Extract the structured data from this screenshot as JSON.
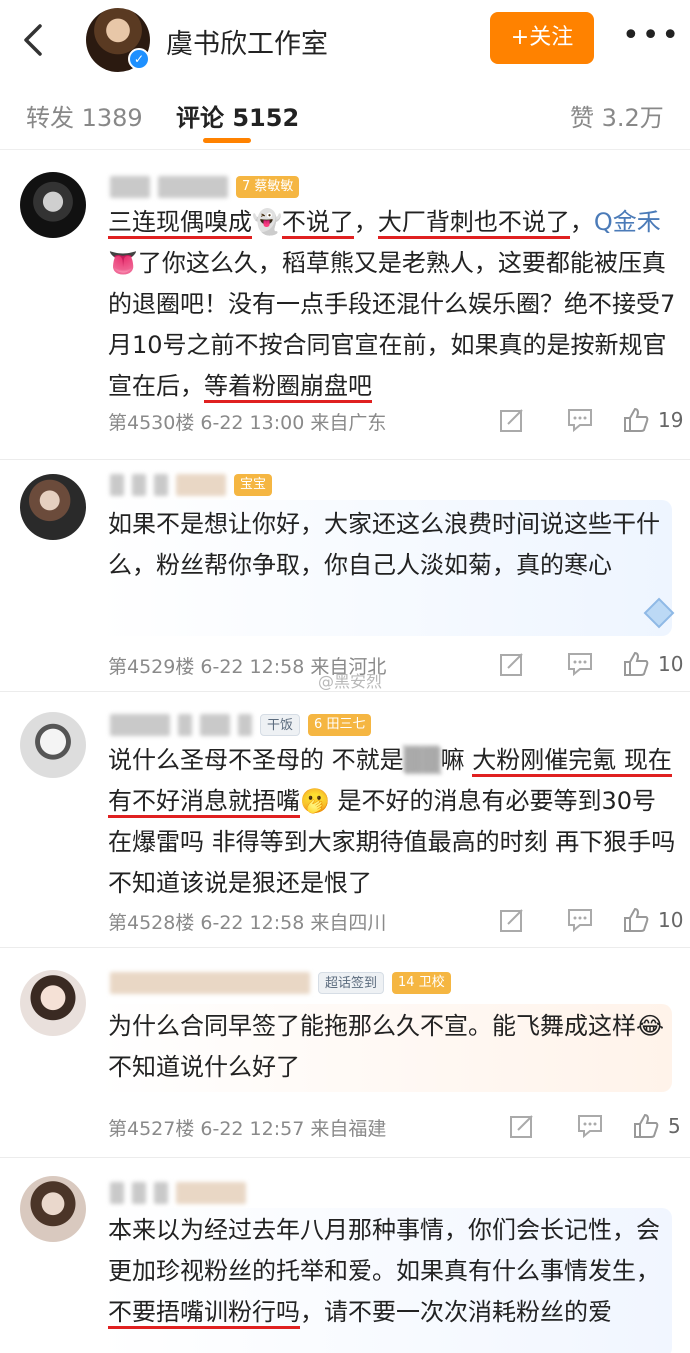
{
  "header": {
    "title": "虞书欣工作室",
    "follow_label": "+关注",
    "more_label": "•••",
    "accent": "#ff8200"
  },
  "tabs": {
    "repost": "转发 1389",
    "comment": "评论 5152",
    "like": "赞 3.2万"
  },
  "comments": [
    {
      "badge": "蔡敏敏",
      "badge_level": "7",
      "text_parts": [
        "三连现偶嗅成",
        "👻",
        "不说了",
        "，",
        "大厂背刺也不说了",
        "，",
        "Q金禾",
        " 👅了你这么久，稻草熊又是老熟人，这要都能被压真的退圈吧！没有一点手段还混什么娱乐圈？绝不接受7月10号之前不按合同官宣在前，如果真的是按新规官宣在后，",
        "等着粉圈崩盘吧"
      ],
      "meta": "第4530楼  6-22 13:00  来自广东",
      "likes": "19"
    },
    {
      "badge": "宝宝",
      "text": "如果不是想让你好，大家还这么浪费时间说这些干什么，粉丝帮你争取，你自己人淡如菊，真的寒心",
      "meta": "第4529楼  6-22 12:58  来自河北",
      "likes": "10"
    },
    {
      "badge_gray": "干饭",
      "badge": "田三七",
      "badge_level": "6",
      "text_parts": [
        "说什么圣母不圣母的 不就是",
        "▒▒",
        "嘛 ",
        "大粉刚催完氪 现在有不好消息就捂嘴",
        "🫢 是不好的消息有必要等到30号在爆雷吗 非得等到大家期待值最高的时刻 再下狠手吗  不知道该说是狠还是恨了"
      ],
      "meta": "第4528楼  6-22 12:58  来自四川",
      "likes": "10"
    },
    {
      "badge_gray": "超话签到",
      "badge": "卫校",
      "badge_level": "14",
      "text": "为什么合同早签了能拖那么久不宣。能飞舞成这样😂不知道说什么好了",
      "meta": "第4527楼  6-22 12:57  来自福建",
      "likes": "5"
    },
    {
      "text_parts": [
        "本来以为经过去年八月那种事情，你们会长记性，会更加珍视粉丝的托举和爱。如果真有什么事情发生，",
        "不要捂嘴训粉行吗",
        "，请不要一次次消耗粉丝的爱"
      ]
    }
  ],
  "watermark": "@黑安烈"
}
